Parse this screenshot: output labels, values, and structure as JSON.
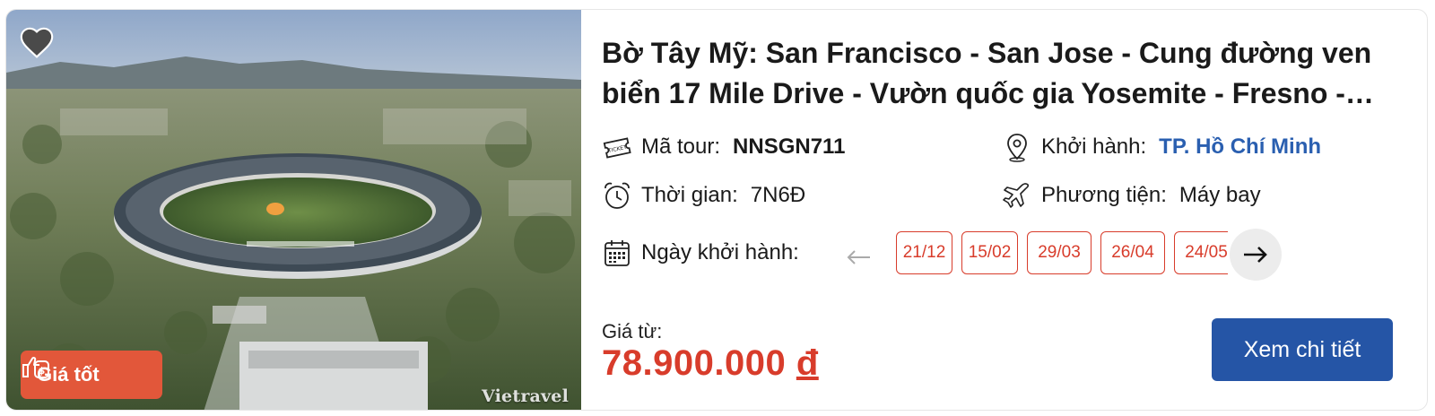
{
  "tour": {
    "title": "Bờ Tây Mỹ: San Francisco - San Jose - Cung đường ven biển 17 Mile Drive - Vườn quốc gia Yosemite - Fresno - Los Angeles",
    "badge_label": "Giá tốt",
    "watermark": "Vietravel",
    "favorite_icon": "heart-icon"
  },
  "details": {
    "code_label": "Mã tour:",
    "code_value": "NNSGN711",
    "departure_label": "Khởi hành:",
    "departure_value": "TP. Hồ Chí Minh",
    "duration_label": "Thời gian:",
    "duration_value": "7N6Đ",
    "transport_label": "Phương tiện:",
    "transport_value": "Máy bay",
    "dates_label": "Ngày khởi hành:",
    "dates": [
      "21/12",
      "15/02",
      "29/03",
      "26/04",
      "24/05"
    ]
  },
  "pricing": {
    "from_label": "Giá từ:",
    "amount": "78.900.000",
    "currency": "đ",
    "cta_label": "Xem chi tiết"
  },
  "colors": {
    "accent_red": "#d83c2b",
    "brand_blue": "#2555a6",
    "link_blue": "#2a5fb0",
    "badge_orange": "#e2573a"
  }
}
